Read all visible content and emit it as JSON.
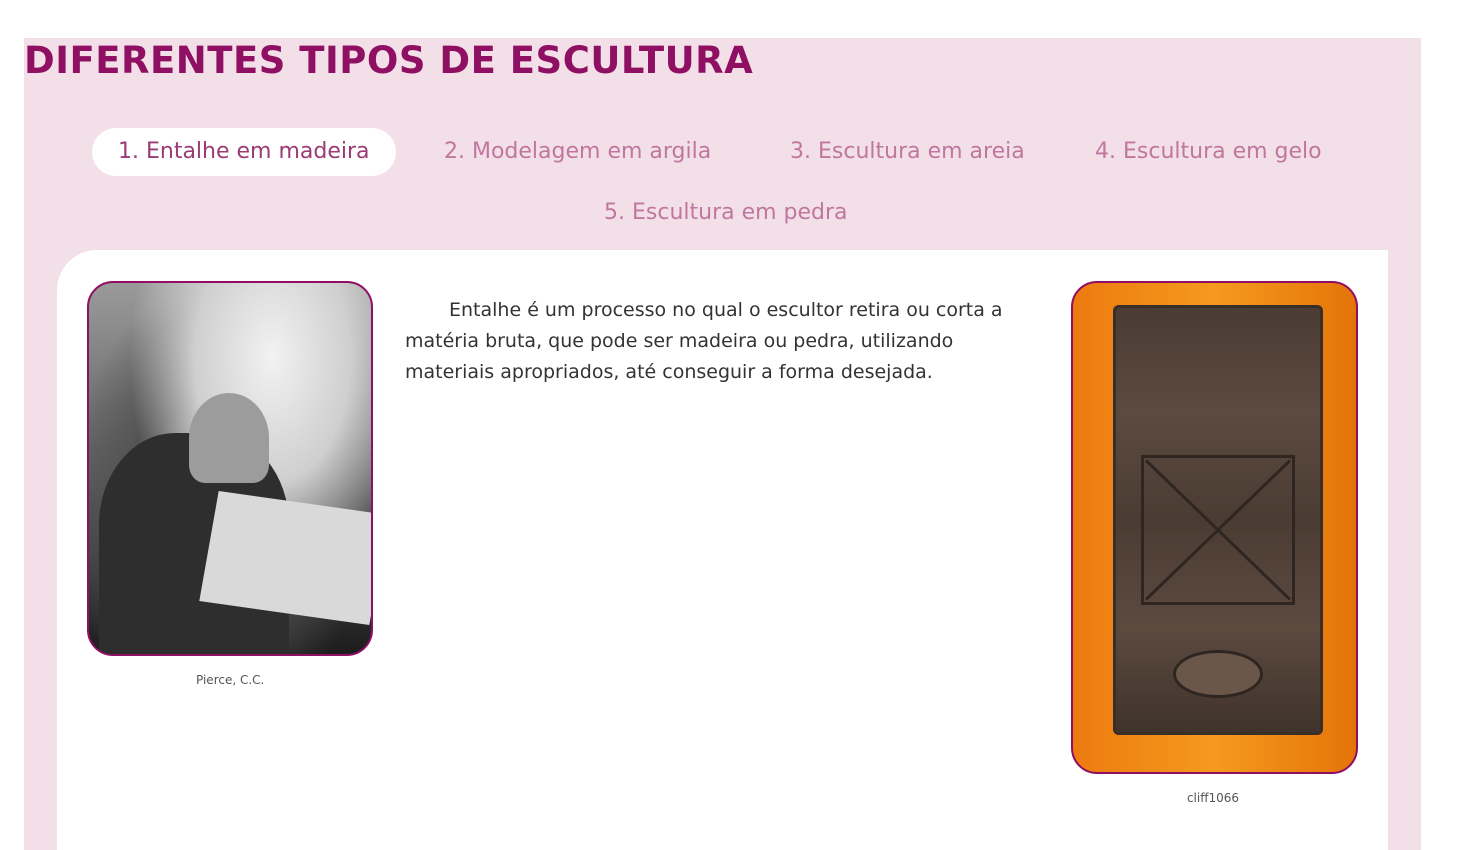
{
  "page": {
    "title": "DIFERENTES TIPOS DE ESCULTURA"
  },
  "tabs": [
    {
      "label": "1. Entalhe em madeira",
      "active": true
    },
    {
      "label": "2. Modelagem em argila",
      "active": false
    },
    {
      "label": "3. Escultura em areia",
      "active": false
    },
    {
      "label": "4. Escultura em gelo",
      "active": false
    },
    {
      "label": "5. Escultura em pedra",
      "active": false
    }
  ],
  "content": {
    "text": "Entalhe é um processo no qual o escultor retira ou corta a matéria bruta, que pode ser madeira ou pedra, utilizando materiais apropriados, até conseguir a forma desejada.",
    "left_image": {
      "caption": "Pierce, C.C."
    },
    "right_image": {
      "caption": "cliff1066"
    }
  },
  "colors": {
    "accent": "#8f0f63",
    "panel_bg": "#f3dfe8",
    "tab_text": "#c0779e"
  }
}
